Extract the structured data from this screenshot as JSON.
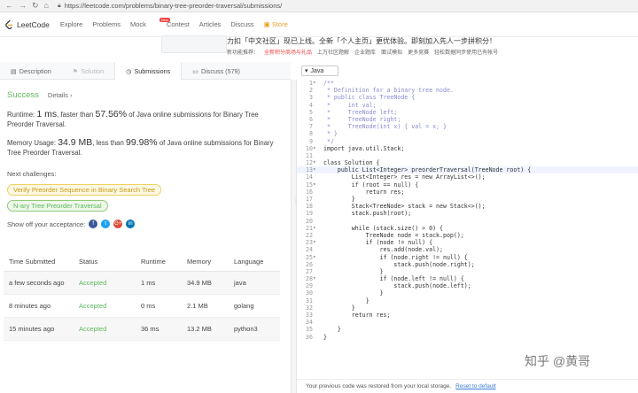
{
  "browser": {
    "url": "https://leetcode.com/problems/binary-tree-preorder-traversal/submissions/"
  },
  "topnav": {
    "logo": "LeetCode",
    "items": [
      "Explore",
      "Problems",
      "Mock",
      "Contest",
      "Articles",
      "Discuss",
      "Store"
    ],
    "new_badge": "New"
  },
  "banner": {
    "line1": "力扣「中文社区」现已上线。全新「个人主页」更优体验。即刻加入先人一步拼积分！",
    "line2": [
      "新功能推荐：",
      "全新积分商场与礼品",
      "上万社区题解",
      "企业题库",
      "面试模拟",
      "更多竞赛",
      "轻松数据同步使用已有帐号"
    ]
  },
  "tabs": [
    {
      "label": "Description",
      "state": "normal"
    },
    {
      "label": "Solution",
      "state": "disabled"
    },
    {
      "label": "Submissions",
      "state": "active"
    },
    {
      "label": "Discuss (579)",
      "state": "normal"
    }
  ],
  "result": {
    "status": "Success",
    "details": "Details",
    "runtime_prefix": "Runtime: ",
    "runtime": "1 ms",
    "runtime_mid": ", faster than ",
    "runtime_pct": "57.56%",
    "runtime_suffix": " of Java online submissions for Binary Tree Preorder Traversal.",
    "memory_prefix": "Memory Usage: ",
    "memory": "34.9 MB",
    "memory_mid": ", less than ",
    "memory_pct": "99.98%",
    "memory_suffix": " of Java online submissions for Binary Tree Preorder Traversal."
  },
  "next": {
    "label": "Next challenges:",
    "chips": [
      "Verify Preorder Sequence in Binary Search Tree",
      "N-ary Tree Preorder Traversal"
    ]
  },
  "share": {
    "label": "Show off your acceptance:",
    "icons": [
      "f",
      "t",
      "G+",
      "in"
    ]
  },
  "table": {
    "headers": [
      "Time Submitted",
      "Status",
      "Runtime",
      "Memory",
      "Language"
    ],
    "rows": [
      [
        "a few seconds ago",
        "Accepted",
        "1 ms",
        "34.9 MB",
        "java"
      ],
      [
        "8 minutes ago",
        "Accepted",
        "0 ms",
        "2.1 MB",
        "golang"
      ],
      [
        "15 minutes ago",
        "Accepted",
        "36 ms",
        "13.2 MB",
        "python3"
      ]
    ]
  },
  "editor": {
    "language": "Java",
    "lines": [
      {
        "n": "1",
        "t": "/**",
        "c": "cm"
      },
      {
        "n": "2",
        "t": " * Definition for a binary tree node.",
        "c": "cm"
      },
      {
        "n": "3",
        "t": " * public class TreeNode {",
        "c": "cm"
      },
      {
        "n": "4",
        "t": " *     int val;",
        "c": "cm"
      },
      {
        "n": "5",
        "t": " *     TreeNode left;",
        "c": "cm"
      },
      {
        "n": "6",
        "t": " *     TreeNode right;",
        "c": "cm"
      },
      {
        "n": "7",
        "t": " *     TreeNode(int x) { val = x; }",
        "c": "cm"
      },
      {
        "n": "8",
        "t": " * }",
        "c": "cm"
      },
      {
        "n": "9",
        "t": " */",
        "c": "cm"
      },
      {
        "n": "10",
        "t": "import java.util.Stack;",
        "c": ""
      },
      {
        "n": "11",
        "t": "",
        "c": ""
      },
      {
        "n": "12",
        "t": "class Solution {",
        "c": ""
      },
      {
        "n": "13",
        "t": "    public List<Integer> preorderTraversal(TreeNode root) {",
        "c": "hl"
      },
      {
        "n": "14",
        "t": "        List<Integer> res = new ArrayList<>();",
        "c": ""
      },
      {
        "n": "15",
        "t": "        if (root == null) {",
        "c": ""
      },
      {
        "n": "16",
        "t": "            return res;",
        "c": ""
      },
      {
        "n": "17",
        "t": "        }",
        "c": ""
      },
      {
        "n": "18",
        "t": "        Stack<TreeNode> stack = new Stack<>();",
        "c": ""
      },
      {
        "n": "19",
        "t": "        stack.push(root);",
        "c": ""
      },
      {
        "n": "20",
        "t": "",
        "c": ""
      },
      {
        "n": "21",
        "t": "        while (stack.size() > 0) {",
        "c": ""
      },
      {
        "n": "22",
        "t": "            TreeNode node = stack.pop();",
        "c": ""
      },
      {
        "n": "23",
        "t": "            if (node != null) {",
        "c": ""
      },
      {
        "n": "24",
        "t": "                res.add(node.val);",
        "c": ""
      },
      {
        "n": "25",
        "t": "                if (node.right != null) {",
        "c": ""
      },
      {
        "n": "26",
        "t": "                    stack.push(node.right);",
        "c": ""
      },
      {
        "n": "27",
        "t": "                }",
        "c": ""
      },
      {
        "n": "28",
        "t": "                if (node.left != null) {",
        "c": ""
      },
      {
        "n": "29",
        "t": "                    stack.push(node.left);",
        "c": ""
      },
      {
        "n": "30",
        "t": "                }",
        "c": ""
      },
      {
        "n": "31",
        "t": "            }",
        "c": ""
      },
      {
        "n": "32",
        "t": "        }",
        "c": ""
      },
      {
        "n": "33",
        "t": "        return res;",
        "c": ""
      },
      {
        "n": "34",
        "t": "",
        "c": ""
      },
      {
        "n": "35",
        "t": "    }",
        "c": ""
      },
      {
        "n": "36",
        "t": "}",
        "c": ""
      }
    ],
    "fold_lines": [
      "1",
      "10",
      "12",
      "13",
      "15",
      "21",
      "23",
      "25",
      "28"
    ]
  },
  "footer": {
    "text": "Your previous code was restored from your local storage.",
    "reset": "Reset to default"
  },
  "watermark": "知乎 @黄哥",
  "colors": {
    "success": "#5cb85c",
    "accent": "#f0a020",
    "link": "#3a7bd5"
  }
}
